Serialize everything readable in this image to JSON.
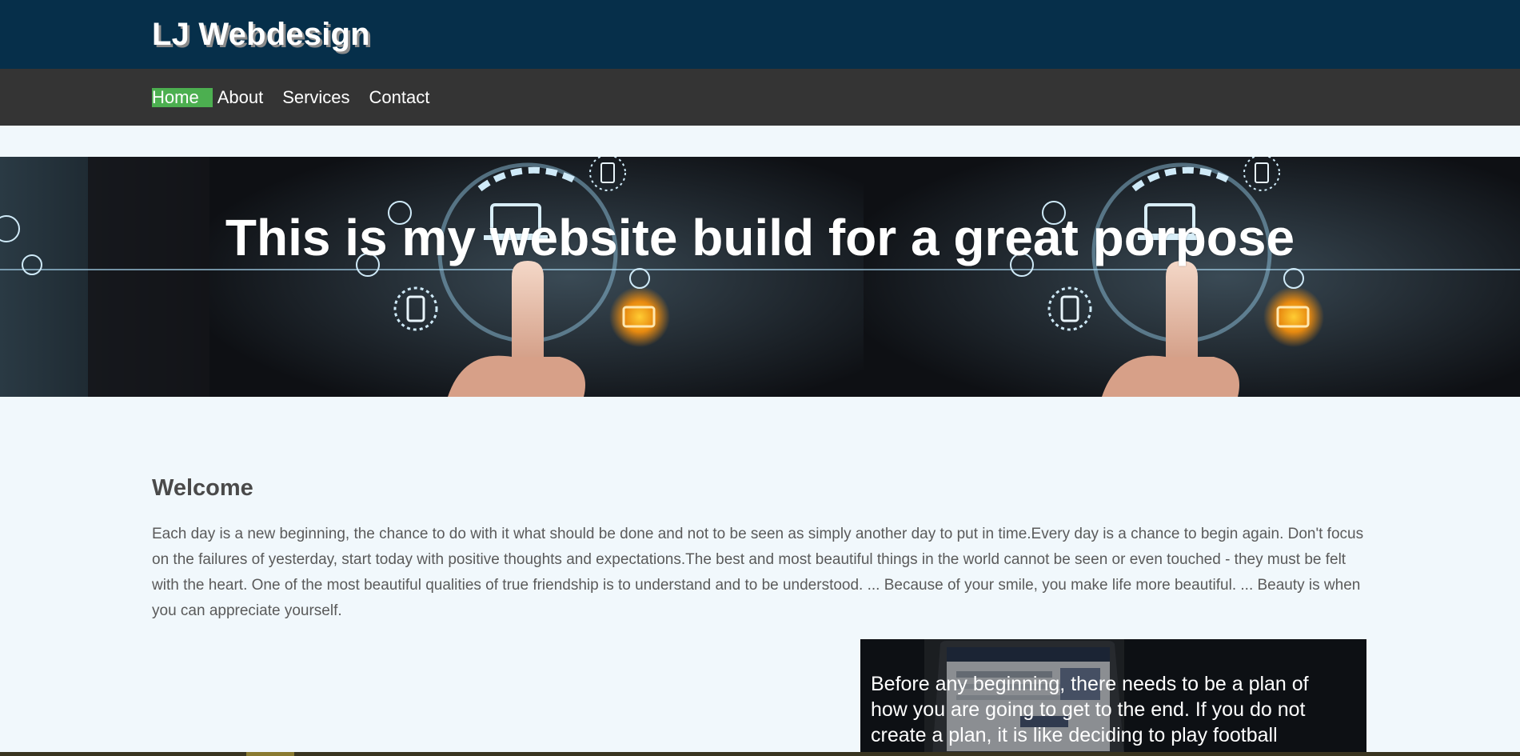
{
  "header": {
    "site_title": "LJ Webdesign"
  },
  "nav": {
    "items": [
      {
        "label": "Home",
        "active": true
      },
      {
        "label": "About",
        "active": false
      },
      {
        "label": "Services",
        "active": false
      },
      {
        "label": "Contact",
        "active": false
      }
    ],
    "active_color": "#4caf50"
  },
  "hero": {
    "title": "This is my website build for a great porpose"
  },
  "main": {
    "welcome_heading": "Welcome",
    "welcome_text": "Each day is a new beginning, the chance to do with it what should be done and not to be seen as simply another day to put in time.Every day is a chance to begin again. Don't focus on the failures of yesterday, start today with positive thoughts and expectations.The best and most beautiful things in the world cannot be seen or even touched - they must be felt with the heart. One of the most beautiful qualities of true friendship is to understand and to be understood. ... Because of your smile, you make life more beautiful. ... Beauty is when you can appreciate yourself."
  },
  "promo": {
    "text": "Before any beginning, there needs to be a plan of how you are going to get to the end. If you do not create a plan, it is like deciding to play football"
  },
  "colors": {
    "header_bg": "#062f4a",
    "nav_bg": "#343434",
    "page_bg": "#f1f8fc",
    "text_gray": "#5a5a5a"
  }
}
